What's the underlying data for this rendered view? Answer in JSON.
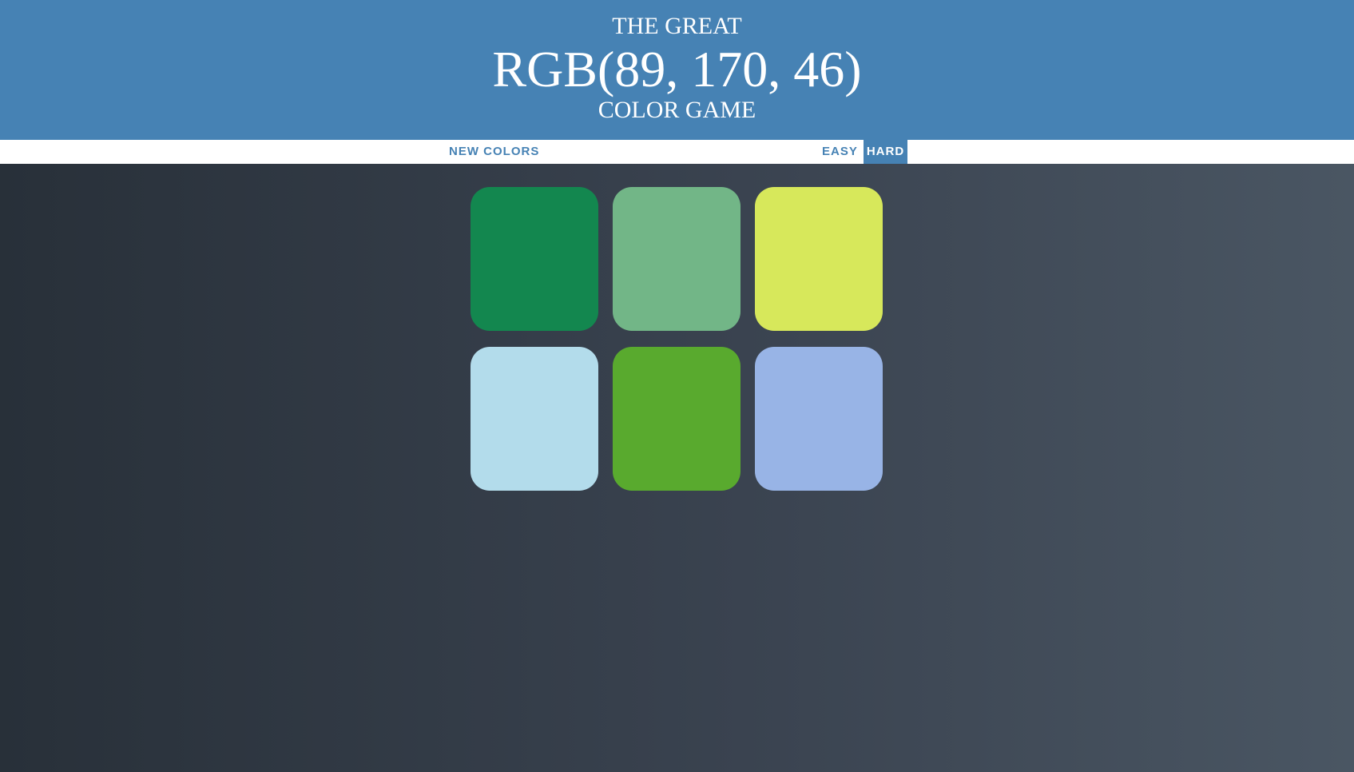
{
  "header": {
    "line1": "THE GREAT",
    "target_color": "RGB(89, 170, 46)",
    "line3": "COLOR GAME",
    "background": "#4682b4"
  },
  "controls": {
    "new_colors": "NEW COLORS",
    "easy": "EASY",
    "hard": "HARD",
    "selected_mode": "HARD"
  },
  "squares": [
    {
      "color": "#13874f"
    },
    {
      "color": "#72b687"
    },
    {
      "color": "#d7e85b"
    },
    {
      "color": "#b3dceb"
    },
    {
      "color": "#59aa2e"
    },
    {
      "color": "#98b4e6"
    }
  ]
}
